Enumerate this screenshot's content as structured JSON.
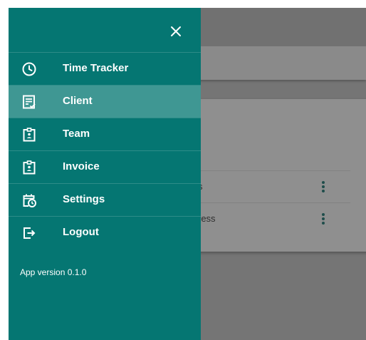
{
  "drawer": {
    "close_icon": "close-icon",
    "items": [
      {
        "label": "Time Tracker",
        "icon": "clock-icon",
        "active": false
      },
      {
        "label": "Client",
        "icon": "checklist-icon",
        "active": true
      },
      {
        "label": "Team",
        "icon": "badge-icon",
        "active": false
      },
      {
        "label": "Invoice",
        "icon": "badge-icon",
        "active": false
      },
      {
        "label": "Settings",
        "icon": "calendar-clock-icon",
        "active": false
      },
      {
        "label": "Logout",
        "icon": "logout-icon",
        "active": false
      }
    ],
    "version": "App version 0.1.0"
  },
  "background": {
    "rows": [
      {
        "text": "s"
      },
      {
        "text": "ress"
      }
    ]
  },
  "colors": {
    "drawer": "#057672",
    "active_item": "#3f9793",
    "scrim": "#757575"
  }
}
